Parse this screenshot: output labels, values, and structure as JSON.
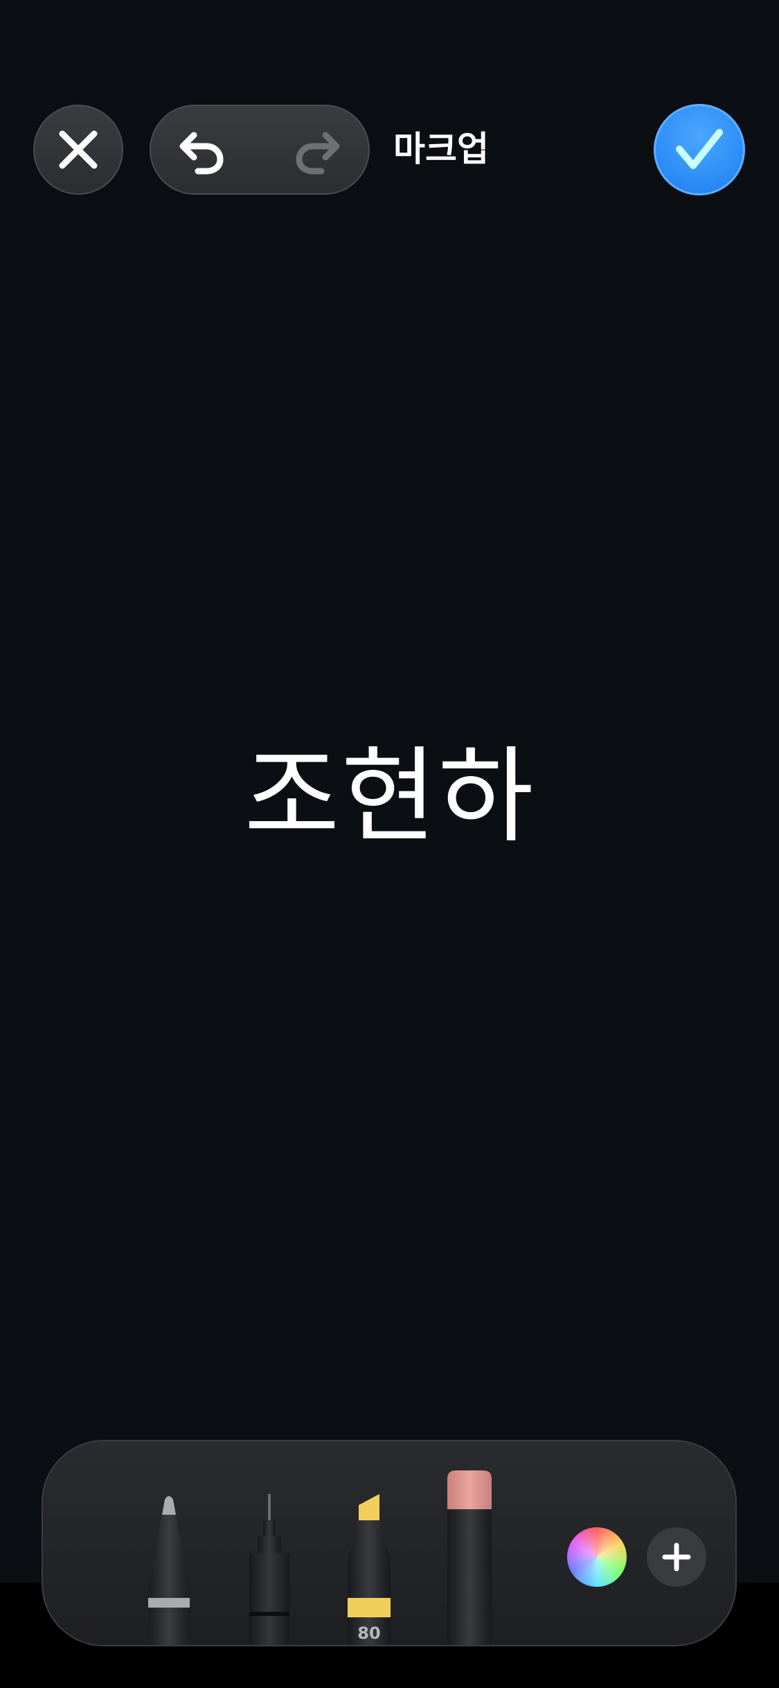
{
  "header": {
    "title": "마크업",
    "close_icon": "close-icon",
    "undo_icon": "undo-icon",
    "redo_icon": "redo-icon",
    "done_icon": "checkmark-icon"
  },
  "canvas": {
    "text": "조현하"
  },
  "palette": {
    "tools": [
      {
        "name": "pen",
        "icon": "pen-icon"
      },
      {
        "name": "fineliner",
        "icon": "fineliner-icon"
      },
      {
        "name": "marker",
        "icon": "marker-icon",
        "label": "80",
        "color": "#f2cf5b"
      },
      {
        "name": "eraser",
        "icon": "eraser-icon",
        "color": "#e8a09a"
      }
    ],
    "color_picker_icon": "color-wheel-icon",
    "add_icon": "plus-icon"
  },
  "colors": {
    "background": "#0b0e13",
    "accent": "#2a8bf5",
    "marker_yellow": "#f2cf5b",
    "eraser_pink": "#e8a09a"
  }
}
